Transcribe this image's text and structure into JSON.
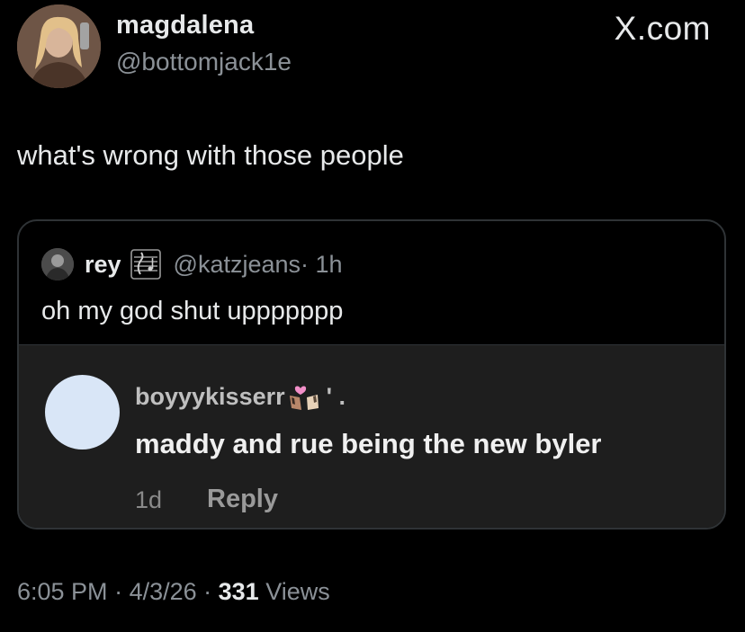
{
  "author": {
    "name": "magdalena",
    "handle": "@bottomjack1e"
  },
  "brand": "X.com",
  "tweet": {
    "text": "what's wrong with those people",
    "time": "6:05 PM",
    "separator": " · ",
    "date": "4/3/26",
    "views_count": "331",
    "views_label": " Views"
  },
  "quote": {
    "name": "rey",
    "handle": "@katzjeans",
    "time": " · 1h",
    "text": "oh my god shut uppppppp",
    "embedded": {
      "username": "boyyykisserr",
      "username_suffix": "' .",
      "text": "maddy and rue being the new byler",
      "time": "1d",
      "reply_label": "Reply"
    }
  },
  "colors": {
    "background": "#000000",
    "primary_text": "#e7e9ea",
    "secondary_text": "#8b9197",
    "card_border": "#2f3336",
    "embed_bg": "#1e1e1e"
  },
  "icons": [
    "music-score-icon",
    "kiss-emoji-icon"
  ]
}
